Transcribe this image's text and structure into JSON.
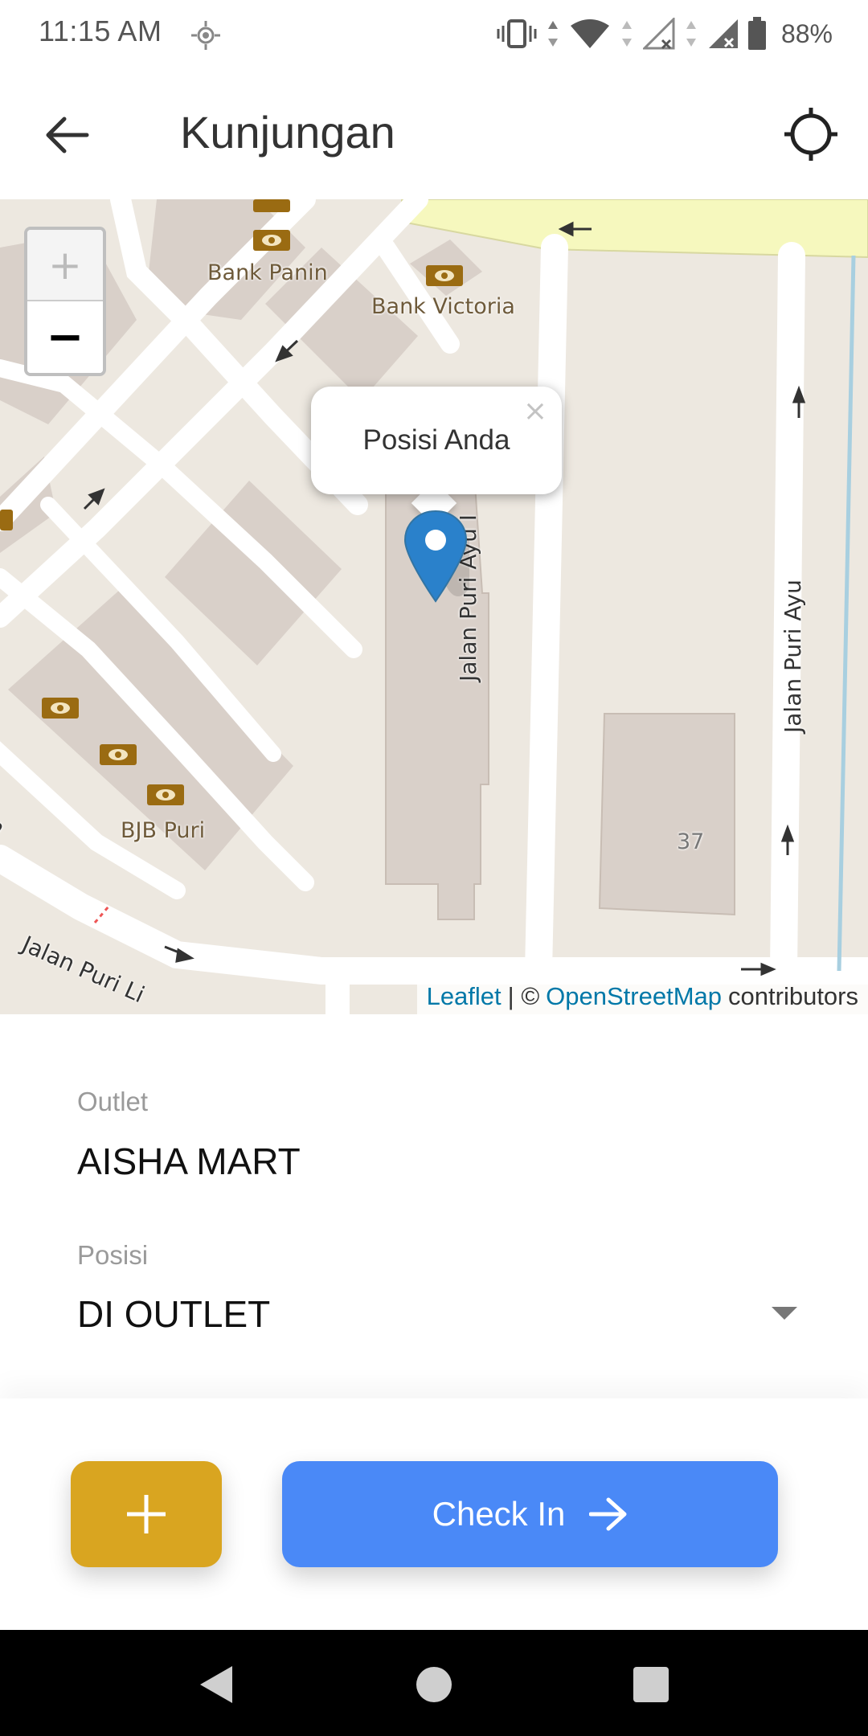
{
  "status_bar": {
    "time": "11:15 AM",
    "battery": "88%",
    "icons": [
      "location-icon",
      "vibrate-icon",
      "wifi-icon",
      "signal-icon",
      "signal-icon",
      "battery-icon"
    ]
  },
  "app_bar": {
    "title": "Kunjungan",
    "back_icon": "arrow-left-icon",
    "action_icon": "crosshair-icon"
  },
  "map": {
    "zoom_in": "+",
    "zoom_out": "−",
    "popup_text": "Posisi Anda",
    "popup_close": "×",
    "labels": {
      "bank_panin": "Bank Panin",
      "bank_victoria": "Bank Victoria",
      "bjb_puri": "BJB Puri",
      "jalan_puri_ayu_i": "Jalan Puri Ayu I",
      "jalan_puri_ayu": "Jalan Puri Ayu",
      "jalan_puri_li": "Jalan Puri Li",
      "number_37": "37",
      "edge_m": "m"
    },
    "attribution": {
      "leaflet": "Leaflet",
      "separator": "| ©",
      "osm": "OpenStreetMap",
      "contributors": "contributors"
    }
  },
  "form": {
    "outlet_label": "Outlet",
    "outlet_value": "AISHA MART",
    "posisi_label": "Posisi",
    "posisi_value": "DI OUTLET"
  },
  "actions": {
    "add_icon": "plus-icon",
    "checkin_label": "Check In",
    "checkin_icon": "arrow-right-icon"
  },
  "colors": {
    "accent_yellow": "#d9a520",
    "accent_blue": "#4a89f7",
    "marker_blue": "#2a81cb"
  },
  "nav_bar": {
    "icons": [
      "back-triangle-icon",
      "home-circle-icon",
      "recents-square-icon"
    ]
  }
}
